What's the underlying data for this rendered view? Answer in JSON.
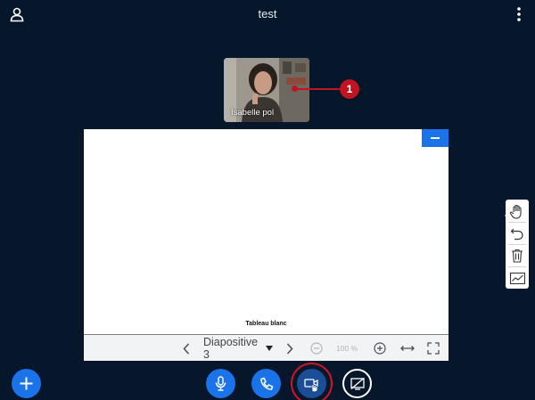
{
  "header": {
    "title": "test",
    "user_icon": "user-icon",
    "options_icon": "vertical-dots-icon"
  },
  "webcam": {
    "participant_name": "Isabelle pol"
  },
  "callout": {
    "number": "1",
    "color": "#c01422"
  },
  "presentation": {
    "slide_label": "Tableau blanc",
    "current_slide": "Diapositive 3",
    "zoom": "100 %",
    "toolbar_icons": [
      "chevron-left-icon",
      "caret-down-icon",
      "chevron-right-icon",
      "zoom-out-icon",
      "zoom-in-icon",
      "fit-width-icon",
      "fullscreen-icon"
    ]
  },
  "whiteboard_tools": [
    "hand-icon",
    "undo-icon",
    "trash-icon",
    "multi-user-whiteboard-icon"
  ],
  "bottom_bar": {
    "buttons": [
      "actions-plus-icon",
      "microphone-icon",
      "phone-icon",
      "webcam-icon",
      "screen-share-icon"
    ],
    "accent_color": "#1a73e8",
    "highlight_ring_color": "#d01428"
  },
  "colors": {
    "background": "#06172b",
    "accent": "#1a73e8"
  }
}
